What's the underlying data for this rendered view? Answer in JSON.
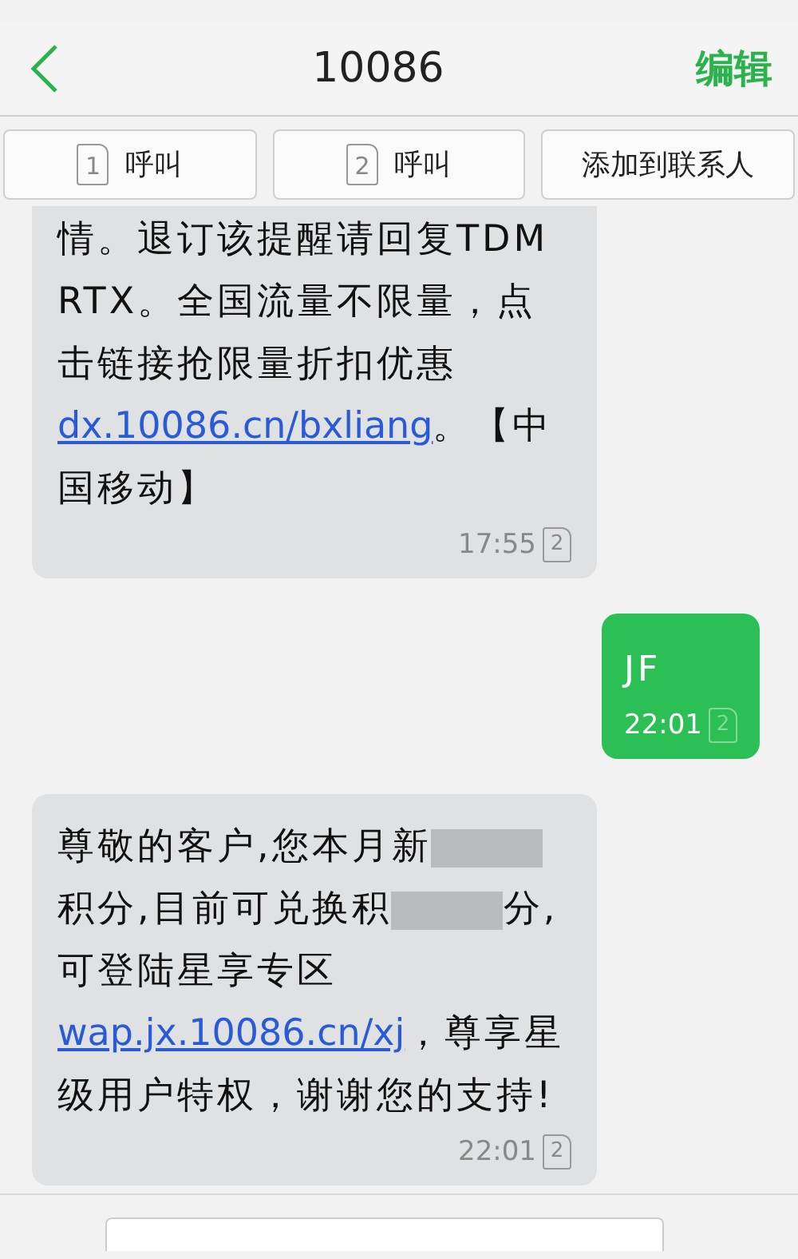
{
  "header": {
    "title": "10086",
    "action": "编辑"
  },
  "actions": [
    {
      "kind": "sim-call",
      "sim": "1",
      "label": "呼叫"
    },
    {
      "kind": "sim-call",
      "sim": "2",
      "label": "呼叫"
    },
    {
      "kind": "plain",
      "label": "添加到联系人"
    }
  ],
  "messages": [
    {
      "kind": "received",
      "segments": [
        {
          "kind": "text",
          "text": "情。退订该提醒请回复TDMRTX。全国流量不限量，点击链接抢限量折扣优惠"
        },
        {
          "kind": "link",
          "text": "dx.10086.cn/bxliang"
        },
        {
          "kind": "text",
          "text": "。【中国移动】"
        }
      ],
      "time": "17:55",
      "sim": "2"
    },
    {
      "kind": "sent",
      "segments": [
        {
          "kind": "text",
          "text": "JF"
        }
      ],
      "time": "22:01",
      "sim": "2"
    },
    {
      "kind": "received",
      "segments": [
        {
          "kind": "text",
          "text": "尊敬的客户,您本月新"
        },
        {
          "kind": "redacted"
        },
        {
          "kind": "text",
          "text": "积分,目前可兑换积"
        },
        {
          "kind": "redacted"
        },
        {
          "kind": "text",
          "text": "分,可登陆星享专区"
        },
        {
          "kind": "link",
          "text": "wap.jx.10086.cn/xj"
        },
        {
          "kind": "text",
          "text": "，尊享星级用户特权，谢谢您的支持!"
        }
      ],
      "time": "22:01",
      "sim": "2"
    }
  ]
}
